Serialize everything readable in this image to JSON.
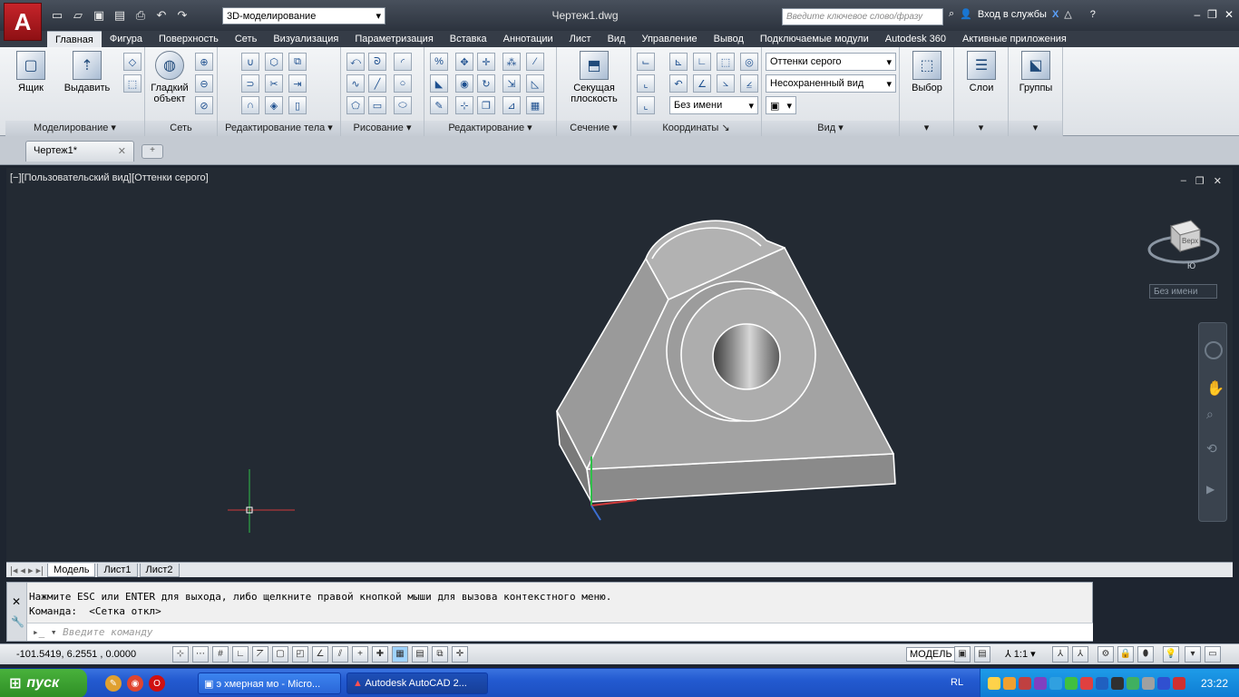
{
  "titlebar": {
    "workspace": "3D-моделирование",
    "document_title": "Чертеж1.dwg",
    "search_placeholder": "Введите ключевое слово/фразу",
    "signin_label": "Вход в службы"
  },
  "ribbon": {
    "tabs": [
      "Главная",
      "Фигура",
      "Поверхность",
      "Сеть",
      "Визуализация",
      "Параметризация",
      "Вставка",
      "Аннотации",
      "Лист",
      "Вид",
      "Управление",
      "Вывод",
      "Подключаемые модули",
      "Autodesk 360",
      "Активные приложения"
    ],
    "active_tab": "Главная",
    "panels": {
      "modeling": {
        "title": "Моделирование",
        "box": "Ящик",
        "extrude": "Выдавить"
      },
      "mesh": {
        "title": "Сеть",
        "smooth_line1": "Гладкий",
        "smooth_line2": "объект"
      },
      "solid_editing": {
        "title": "Редактирование тела"
      },
      "draw": {
        "title": "Рисование"
      },
      "modify": {
        "title": "Редактирование"
      },
      "section": {
        "title": "Сечение",
        "plane_line1": "Секущая",
        "plane_line2": "плоскость"
      },
      "coordinates": {
        "title": "Координаты",
        "ucs_name": "Без имени"
      },
      "view": {
        "title": "Вид",
        "visual_style": "Оттенки серого",
        "saved_view": "Несохраненный вид"
      },
      "selection": {
        "label": "Выбор"
      },
      "layers": {
        "label": "Слои"
      },
      "groups": {
        "label": "Группы"
      }
    }
  },
  "doc_tab": {
    "label": "Чертеж1*"
  },
  "viewport": {
    "label": "[−][Пользовательский вид][Оттенки серого]",
    "viewcube_face": "Верх",
    "viewcube_south": "Ю",
    "ucs_name": "Без имени"
  },
  "layout_tabs": [
    "Модель",
    "Лист1",
    "Лист2"
  ],
  "command": {
    "line1": "Нажмите ESC или ENTER для выхода, либо щелкните правой кнопкой мыши для вызова контекстного меню.",
    "line2": "Команда:  <Сетка откл>",
    "placeholder": "Введите команду"
  },
  "statusbar": {
    "coords": "-101.5419, 6.2551 , 0.0000",
    "model": "МОДЕЛЬ",
    "scale": "1:1"
  },
  "taskbar": {
    "start": "пуск",
    "tasks": [
      "э хмерная мо - Micro...",
      "Autodesk AutoCAD 2..."
    ],
    "lang": "RL",
    "clock": "23:22"
  },
  "colors": {
    "ucs_x": "#d23b3b",
    "ucs_y": "#2fbf4a",
    "ucs_z": "#3b6ed2",
    "accent": "#c6242a"
  }
}
